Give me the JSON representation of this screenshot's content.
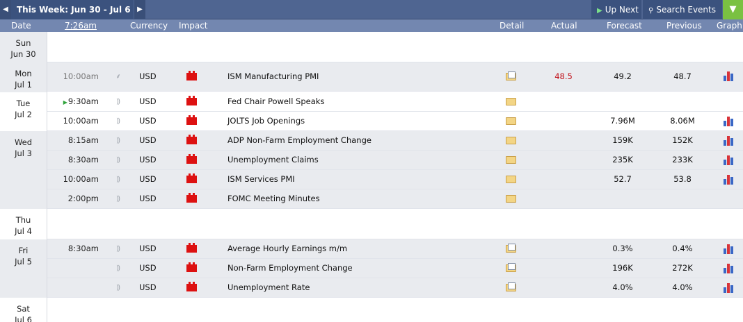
{
  "toolbar": {
    "week_label": "This Week: Jun 30 - Jul 6",
    "prev_arrow": "◀",
    "next_arrow": "▶",
    "up_next_label": "Up Next",
    "up_next_glyph": "▶",
    "search_label": "Search Events",
    "search_glyph": "🔍",
    "filter_glyph": "▼"
  },
  "columns": {
    "date": "Date",
    "time": "7:26am",
    "currency": "Currency",
    "impact": "Impact",
    "detail": "Detail",
    "actual": "Actual",
    "forecast": "Forecast",
    "previous": "Previous",
    "graph": "Graph"
  },
  "days": [
    {
      "day": "Sun",
      "date": "Jun 30"
    },
    {
      "day": "Mon",
      "date": "Jul 1"
    },
    {
      "day": "Tue",
      "date": "Jul 2"
    },
    {
      "day": "Wed",
      "date": "Jul 3"
    },
    {
      "day": "Thu",
      "date": "Jul 4"
    },
    {
      "day": "Fri",
      "date": "Jul 5"
    },
    {
      "day": "Sat",
      "date": "Jul 6"
    }
  ],
  "events": [
    {
      "time": "10:00am",
      "currency": "USD",
      "event": "ISM Manufacturing PMI",
      "actual": "48.5",
      "forecast": "49.2",
      "previous": "48.7"
    },
    {
      "time": "9:30am",
      "currency": "USD",
      "event": "Fed Chair Powell Speaks",
      "actual": "",
      "forecast": "",
      "previous": ""
    },
    {
      "time": "10:00am",
      "currency": "USD",
      "event": "JOLTS Job Openings",
      "actual": "",
      "forecast": "7.96M",
      "previous": "8.06M"
    },
    {
      "time": "8:15am",
      "currency": "USD",
      "event": "ADP Non-Farm Employment Change",
      "actual": "",
      "forecast": "159K",
      "previous": "152K"
    },
    {
      "time": "8:30am",
      "currency": "USD",
      "event": "Unemployment Claims",
      "actual": "",
      "forecast": "235K",
      "previous": "233K"
    },
    {
      "time": "10:00am",
      "currency": "USD",
      "event": "ISM Services PMI",
      "actual": "",
      "forecast": "52.7",
      "previous": "53.8"
    },
    {
      "time": "2:00pm",
      "currency": "USD",
      "event": "FOMC Meeting Minutes",
      "actual": "",
      "forecast": "",
      "previous": ""
    },
    {
      "time": "8:30am",
      "currency": "USD",
      "event": "Average Hourly Earnings m/m",
      "actual": "",
      "forecast": "0.3%",
      "previous": "0.4%"
    },
    {
      "time": "",
      "currency": "USD",
      "event": "Non-Farm Employment Change",
      "actual": "",
      "forecast": "196K",
      "previous": "272K"
    },
    {
      "time": "",
      "currency": "USD",
      "event": "Unemployment Rate",
      "actual": "",
      "forecast": "4.0%",
      "previous": "4.0%"
    }
  ],
  "icons": {
    "signal": "📶",
    "sound": ")",
    "impact": "high-impact-folder-icon",
    "detail": "detail-folder-icon",
    "graph": "bar-chart-icon"
  },
  "colors": {
    "toolbar_bg": "#4f6591",
    "header_bg": "#7387b0",
    "filter_bg": "#7ac142",
    "actual_red": "#c2121b",
    "impact_red": "#dd1111"
  }
}
